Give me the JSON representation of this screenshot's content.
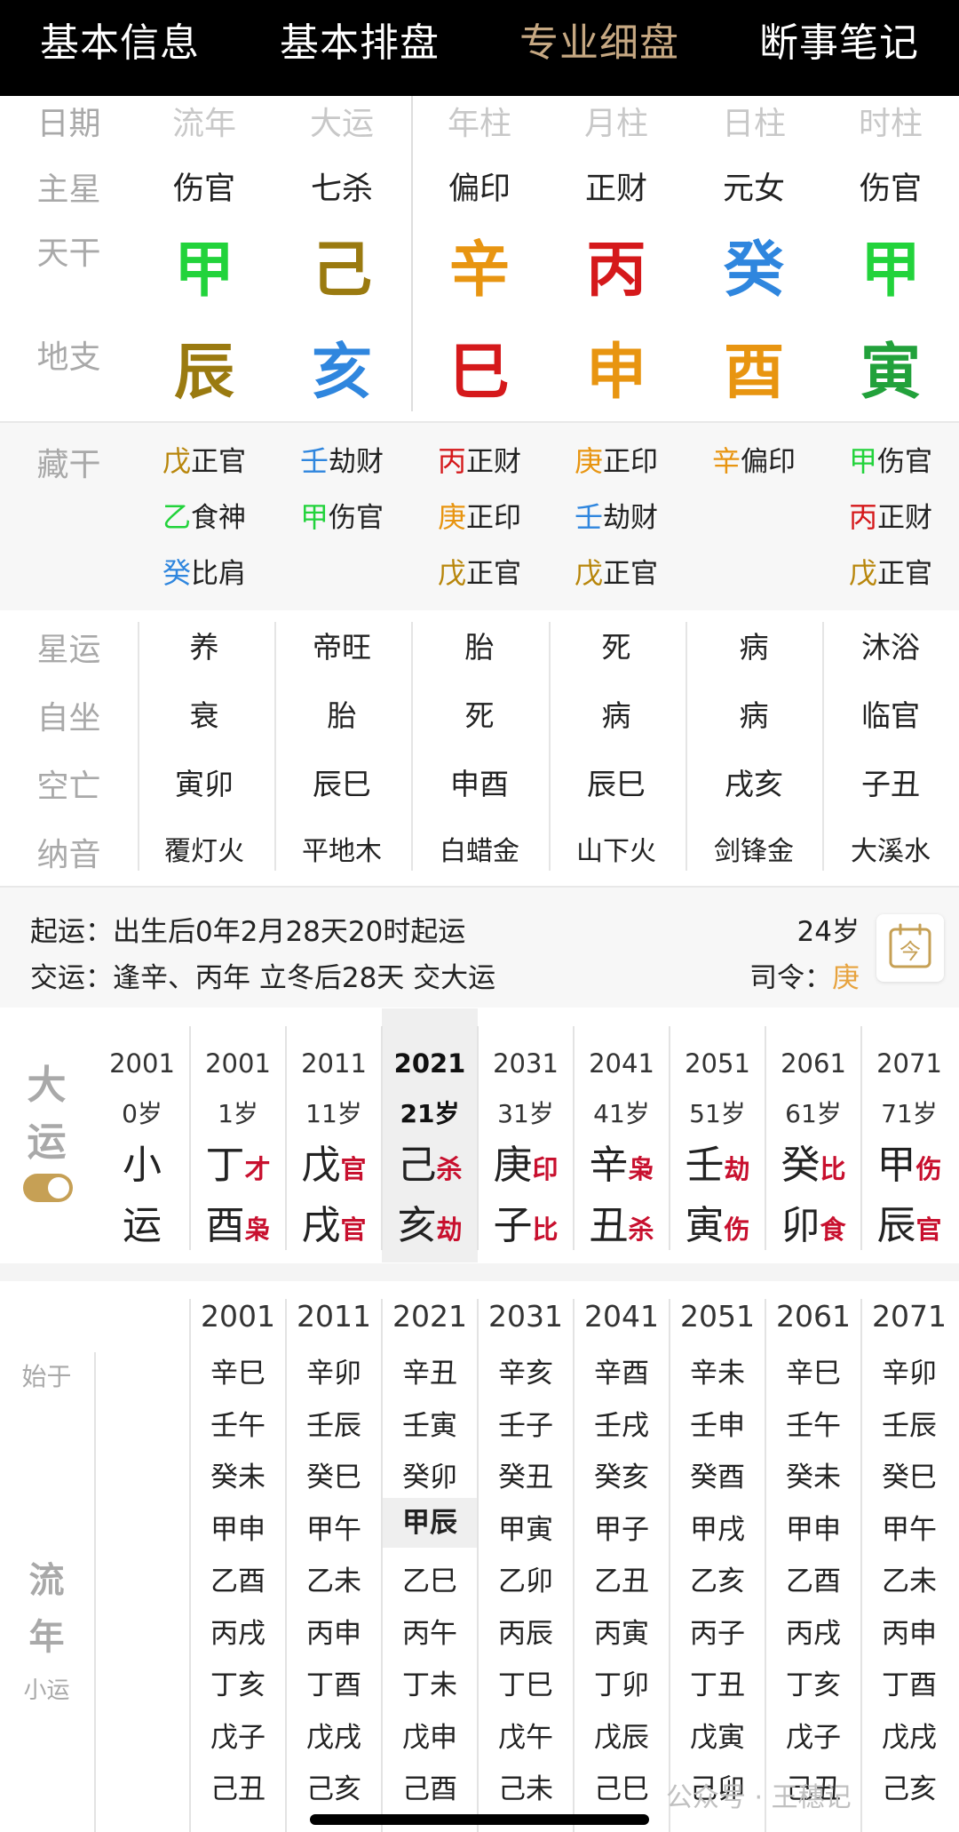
{
  "tabs": [
    "基本信息",
    "基本排盘",
    "专业细盘",
    "断事笔记"
  ],
  "active_tab": "专业细盘",
  "row_labels": {
    "date": "日期",
    "main_star": "主星",
    "stem": "天干",
    "branch": "地支",
    "hidden": "藏干",
    "star_luck": "星运",
    "self_seat": "自坐",
    "void": "空亡",
    "nayin": "纳音"
  },
  "column_headers": [
    "流年",
    "大运",
    "年柱",
    "月柱",
    "日柱",
    "时柱"
  ],
  "main_stars": [
    "伤官",
    "七杀",
    "偏印",
    "正财",
    "元女",
    "伤官"
  ],
  "stems": [
    {
      "char": "甲",
      "color": "#22d33b"
    },
    {
      "char": "己",
      "color": "#9a7a10"
    },
    {
      "char": "辛",
      "color": "#e89511"
    },
    {
      "char": "丙",
      "color": "#d5191b"
    },
    {
      "char": "癸",
      "color": "#2f86de"
    },
    {
      "char": "甲",
      "color": "#22d33b"
    }
  ],
  "branches": [
    {
      "char": "辰",
      "color": "#9a7a10"
    },
    {
      "char": "亥",
      "color": "#2f86de"
    },
    {
      "char": "巳",
      "color": "#d5191b"
    },
    {
      "char": "申",
      "color": "#e89511"
    },
    {
      "char": "酉",
      "color": "#e89511"
    },
    {
      "char": "寅",
      "color": "#22a13b"
    }
  ],
  "hidden_stems": [
    [
      {
        "s": "戊",
        "c": "#b8860b",
        "g": "正官"
      },
      {
        "s": "乙",
        "c": "#22d33b",
        "g": "食神"
      },
      {
        "s": "癸",
        "c": "#2f86de",
        "g": "比肩"
      }
    ],
    [
      {
        "s": "壬",
        "c": "#2f86de",
        "g": "劫财"
      },
      {
        "s": "甲",
        "c": "#22d33b",
        "g": "伤官"
      }
    ],
    [
      {
        "s": "丙",
        "c": "#d5191b",
        "g": "正财"
      },
      {
        "s": "庚",
        "c": "#e89511",
        "g": "正印"
      },
      {
        "s": "戊",
        "c": "#b8860b",
        "g": "正官"
      }
    ],
    [
      {
        "s": "庚",
        "c": "#e89511",
        "g": "正印"
      },
      {
        "s": "壬",
        "c": "#2f86de",
        "g": "劫财"
      },
      {
        "s": "戊",
        "c": "#b8860b",
        "g": "正官"
      }
    ],
    [
      {
        "s": "辛",
        "c": "#e89511",
        "g": "偏印"
      }
    ],
    [
      {
        "s": "甲",
        "c": "#22d33b",
        "g": "伤官"
      },
      {
        "s": "丙",
        "c": "#d5191b",
        "g": "正财"
      },
      {
        "s": "戊",
        "c": "#b8860b",
        "g": "正官"
      }
    ]
  ],
  "star_luck": [
    "养",
    "帝旺",
    "胎",
    "死",
    "病",
    "沐浴"
  ],
  "self_seat": [
    "衰",
    "胎",
    "死",
    "病",
    "病",
    "临官"
  ],
  "void": [
    "寅卯",
    "辰巳",
    "申酉",
    "辰巳",
    "戌亥",
    "子丑"
  ],
  "nayin": [
    "覆灯火",
    "平地木",
    "白蜡金",
    "山下火",
    "剑锋金",
    "大溪水"
  ],
  "luck_info": {
    "start_label": "起运：",
    "start_text": "出生后0年2月28天20时起运",
    "change_label": "交运：",
    "change_text": "逢辛、丙年 立冬后28天 交大运",
    "age": "24岁",
    "siling_label": "司令：",
    "siling_value": "庚",
    "today_icon": "calendar-today-icon",
    "today_char": "今"
  },
  "decades": {
    "label": [
      "大",
      "运"
    ],
    "toggle_on": true,
    "columns": [
      {
        "year": "2001",
        "age": "0岁",
        "xiao": [
          "小",
          "运"
        ]
      },
      {
        "year": "2001",
        "age": "1岁",
        "g1": "丁",
        "s1": "才",
        "g2": "酉",
        "s2": "枭"
      },
      {
        "year": "2011",
        "age": "11岁",
        "g1": "戊",
        "s1": "官",
        "g2": "戌",
        "s2": "官"
      },
      {
        "year": "2021",
        "age": "21岁",
        "g1": "己",
        "s1": "杀",
        "g2": "亥",
        "s2": "劫",
        "selected": true
      },
      {
        "year": "2031",
        "age": "31岁",
        "g1": "庚",
        "s1": "印",
        "g2": "子",
        "s2": "比"
      },
      {
        "year": "2041",
        "age": "41岁",
        "g1": "辛",
        "s1": "枭",
        "g2": "丑",
        "s2": "杀"
      },
      {
        "year": "2051",
        "age": "51岁",
        "g1": "壬",
        "s1": "劫",
        "g2": "寅",
        "s2": "伤"
      },
      {
        "year": "2061",
        "age": "61岁",
        "g1": "癸",
        "s1": "比",
        "g2": "卯",
        "s2": "食"
      },
      {
        "year": "2071",
        "age": "71岁",
        "g1": "甲",
        "s1": "伤",
        "g2": "辰",
        "s2": "官"
      }
    ]
  },
  "annual": {
    "start_label": "始于",
    "label": [
      "流",
      "年"
    ],
    "sub_label": "小运",
    "columns": [
      {
        "year": "2001",
        "cells": [
          "辛巳",
          "壬午",
          "癸未",
          "甲申",
          "乙酉",
          "丙戌",
          "丁亥",
          "戊子",
          "己丑"
        ]
      },
      {
        "year": "2011",
        "cells": [
          "辛卯",
          "壬辰",
          "癸巳",
          "甲午",
          "乙未",
          "丙申",
          "丁酉",
          "戊戌",
          "己亥"
        ]
      },
      {
        "year": "2021",
        "cells": [
          "辛丑",
          "壬寅",
          "癸卯",
          "甲辰",
          "乙巳",
          "丙午",
          "丁未",
          "戊申",
          "己酉"
        ],
        "current_index": 3
      },
      {
        "year": "2031",
        "cells": [
          "辛亥",
          "壬子",
          "癸丑",
          "甲寅",
          "乙卯",
          "丙辰",
          "丁巳",
          "戊午",
          "己未"
        ]
      },
      {
        "year": "2041",
        "cells": [
          "辛酉",
          "壬戌",
          "癸亥",
          "甲子",
          "乙丑",
          "丙寅",
          "丁卯",
          "戊辰",
          "己巳"
        ]
      },
      {
        "year": "2051",
        "cells": [
          "辛未",
          "壬申",
          "癸酉",
          "甲戌",
          "乙亥",
          "丙子",
          "丁丑",
          "戊寅",
          "己卯"
        ]
      },
      {
        "year": "2061",
        "cells": [
          "辛巳",
          "壬午",
          "癸未",
          "甲申",
          "乙酉",
          "丙戌",
          "丁亥",
          "戊子",
          "己丑"
        ]
      },
      {
        "year": "2071",
        "cells": [
          "辛卯",
          "壬辰",
          "癸巳",
          "甲午",
          "乙未",
          "丙申",
          "丁酉",
          "戊戌",
          "己亥"
        ]
      }
    ]
  },
  "watermark": "公众号 · 王穗记"
}
